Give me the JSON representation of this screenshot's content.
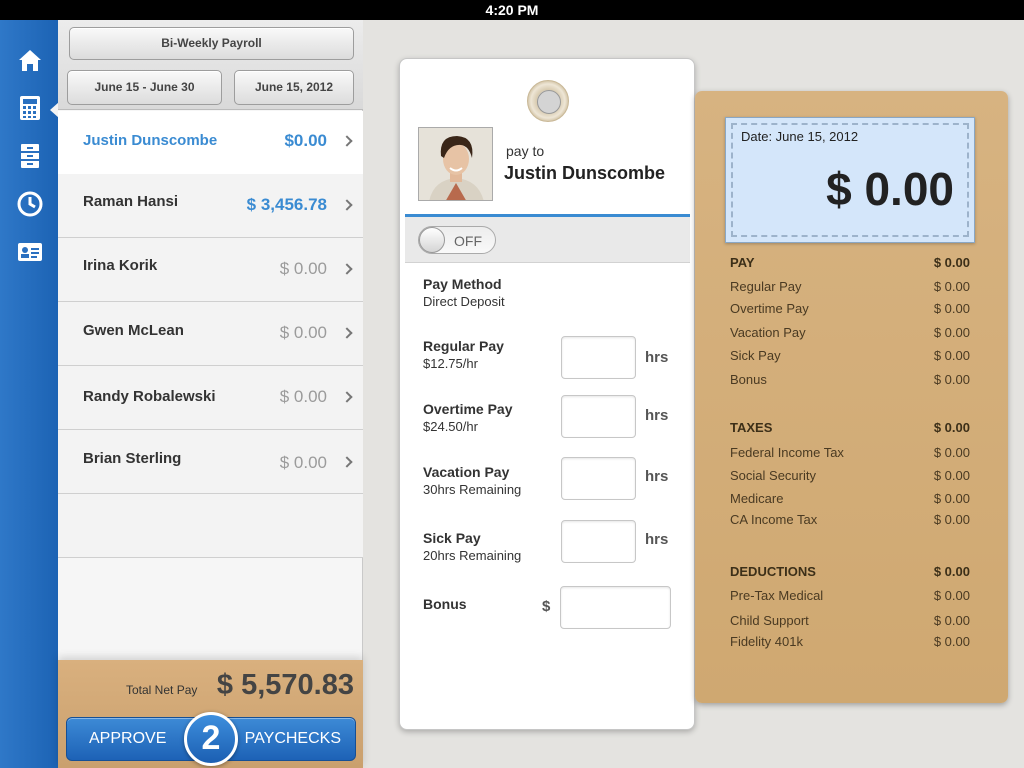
{
  "status_bar": {
    "time": "4:20 PM"
  },
  "nav": {
    "items": [
      {
        "name": "home"
      },
      {
        "name": "payroll-calculator",
        "active": true
      },
      {
        "name": "records"
      },
      {
        "name": "history"
      },
      {
        "name": "employees"
      }
    ]
  },
  "list": {
    "payroll_type": "Bi-Weekly Payroll",
    "period": "June 15 - June 30",
    "pay_date": "June 15, 2012",
    "employees": [
      {
        "name": "Justin Dunscombe",
        "amount": "$0.00",
        "selected": true
      },
      {
        "name": "Raman Hansi",
        "amount": "$ 3,456.78"
      },
      {
        "name": "Irina Korik",
        "amount": "$ 0.00"
      },
      {
        "name": "Gwen McLean",
        "amount": "$ 0.00"
      },
      {
        "name": "Randy Robalewski",
        "amount": "$ 0.00"
      },
      {
        "name": "Brian Sterling",
        "amount": "$ 0.00"
      }
    ]
  },
  "footer": {
    "total_label": "Total Net Pay",
    "total_value": "$ 5,570.83",
    "approve_label": "APPROVE",
    "count": "2",
    "paychecks_label": "PAYCHECKS"
  },
  "detail": {
    "pay_to_label": "pay to",
    "employee_name": "Justin Dunscombe",
    "toggle_label": "OFF",
    "pay_method_label": "Pay Method",
    "pay_method_value": "Direct Deposit",
    "regular_label": "Regular Pay",
    "regular_rate": "$12.75/hr",
    "overtime_label": "Overtime Pay",
    "overtime_rate": "$24.50/hr",
    "vacation_label": "Vacation Pay",
    "vacation_remaining": "30hrs Remaining",
    "sick_label": "Sick Pay",
    "sick_remaining": "20hrs Remaining",
    "bonus_label": "Bonus",
    "hrs_unit": "hrs",
    "dollar_unit": "$"
  },
  "stub": {
    "date": "Date: June 15, 2012",
    "amount": "$ 0.00",
    "pay": {
      "title": "PAY",
      "total": "$ 0.00",
      "rows": [
        {
          "label": "Regular Pay",
          "value": "$ 0.00"
        },
        {
          "label": "Overtime Pay",
          "value": "$ 0.00"
        },
        {
          "label": "Vacation Pay",
          "value": "$ 0.00"
        },
        {
          "label": "Sick Pay",
          "value": "$ 0.00"
        },
        {
          "label": "Bonus",
          "value": "$ 0.00"
        }
      ]
    },
    "taxes": {
      "title": "TAXES",
      "total": "$ 0.00",
      "rows": [
        {
          "label": "Federal Income Tax",
          "value": "$ 0.00"
        },
        {
          "label": "Social Security",
          "value": "$ 0.00"
        },
        {
          "label": "Medicare",
          "value": "$ 0.00"
        },
        {
          "label": "CA Income Tax",
          "value": "$ 0.00"
        }
      ]
    },
    "deductions": {
      "title": "DEDUCTIONS",
      "total": "$ 0.00",
      "rows": [
        {
          "label": "Pre-Tax Medical",
          "value": "$ 0.00"
        },
        {
          "label": "Child Support",
          "value": "$ 0.00"
        },
        {
          "label": "Fidelity 401k",
          "value": "$ 0.00"
        }
      ]
    }
  }
}
